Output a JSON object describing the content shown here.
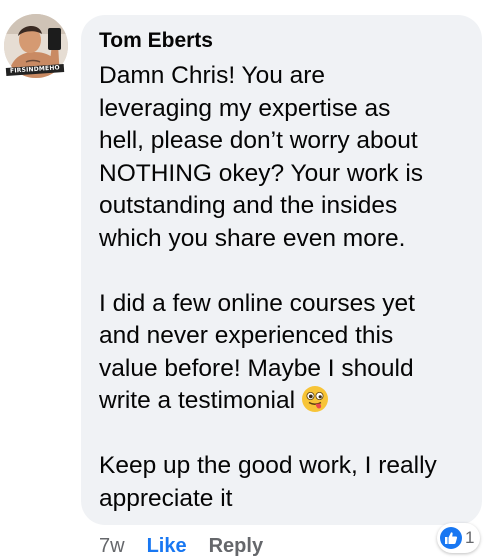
{
  "comment": {
    "author": "Tom Eberts",
    "avatar_caption": "FIRSINDMEHO",
    "paragraphs": [
      "Damn Chris! You are\nleveraging my expertise as\nhell, please don’t worry about\nNOTHING okey? Your work is\noutstanding and the insides\nwhich you share even more.",
      "I did a few online courses yet\nand never experienced this\nvalue before! Maybe I should\nwrite a testimonial",
      "Keep up the good work, I really\nappreciate it"
    ],
    "emoji": "winking-tongue-face-emoji"
  },
  "actions": {
    "time": "7w",
    "like_label": "Like",
    "reply_label": "Reply"
  },
  "reactions": {
    "icon": "thumbs-up-icon",
    "count": "1",
    "color": "#1877f2"
  },
  "colors": {
    "bubble": "#f0f2f5",
    "text": "#050505",
    "secondary": "#65676b",
    "accent": "#1877f2"
  }
}
